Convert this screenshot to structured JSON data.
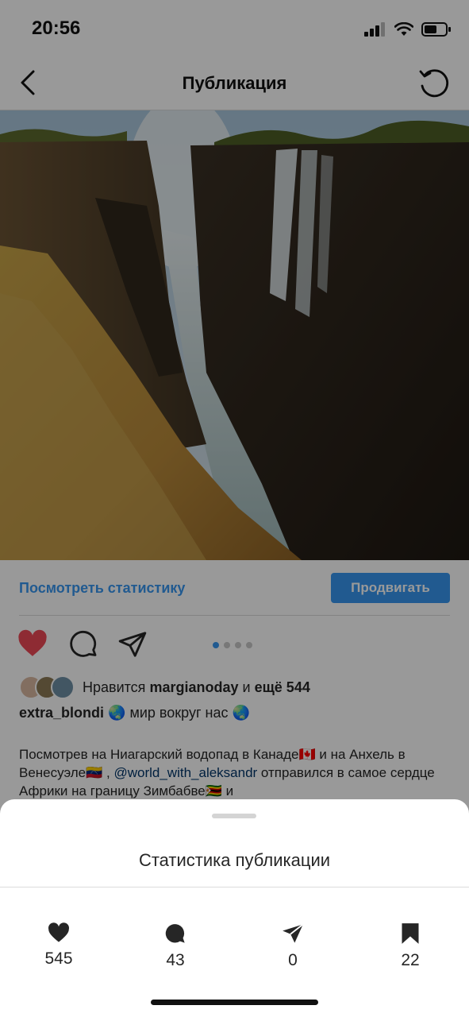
{
  "status_bar": {
    "time": "20:56"
  },
  "nav": {
    "title": "Публикация"
  },
  "post": {
    "view_stats_label": "Посмотреть статистику",
    "promote_label": "Продвигать",
    "carousel": {
      "total": 4,
      "current": 1
    },
    "likes": {
      "prefix": "Нравится",
      "user": "margianoday",
      "conj": "и",
      "others": "ещё 544"
    },
    "caption": {
      "author": "extra_blondi",
      "text": "🌏 мир вокруг нас 🌏"
    },
    "description": {
      "part1": "Посмотрев на Ниагарский водопад в Канаде🇨🇦  и на Анхель в Венесуэле🇻🇪 , ",
      "mention": "@world_with_aleksandr",
      "part2": " отправился в самое сердце Африки на границу Зимбабве🇿🇼 и"
    }
  },
  "sheet": {
    "title": "Статистика публикации",
    "stats": [
      {
        "icon": "heart-icon",
        "value": "545"
      },
      {
        "icon": "comment-icon",
        "value": "43"
      },
      {
        "icon": "send-icon",
        "value": "0"
      },
      {
        "icon": "bookmark-icon",
        "value": "22"
      }
    ]
  },
  "colors": {
    "accent": "#3897f0",
    "like": "#ed4956",
    "link": "#003569"
  }
}
